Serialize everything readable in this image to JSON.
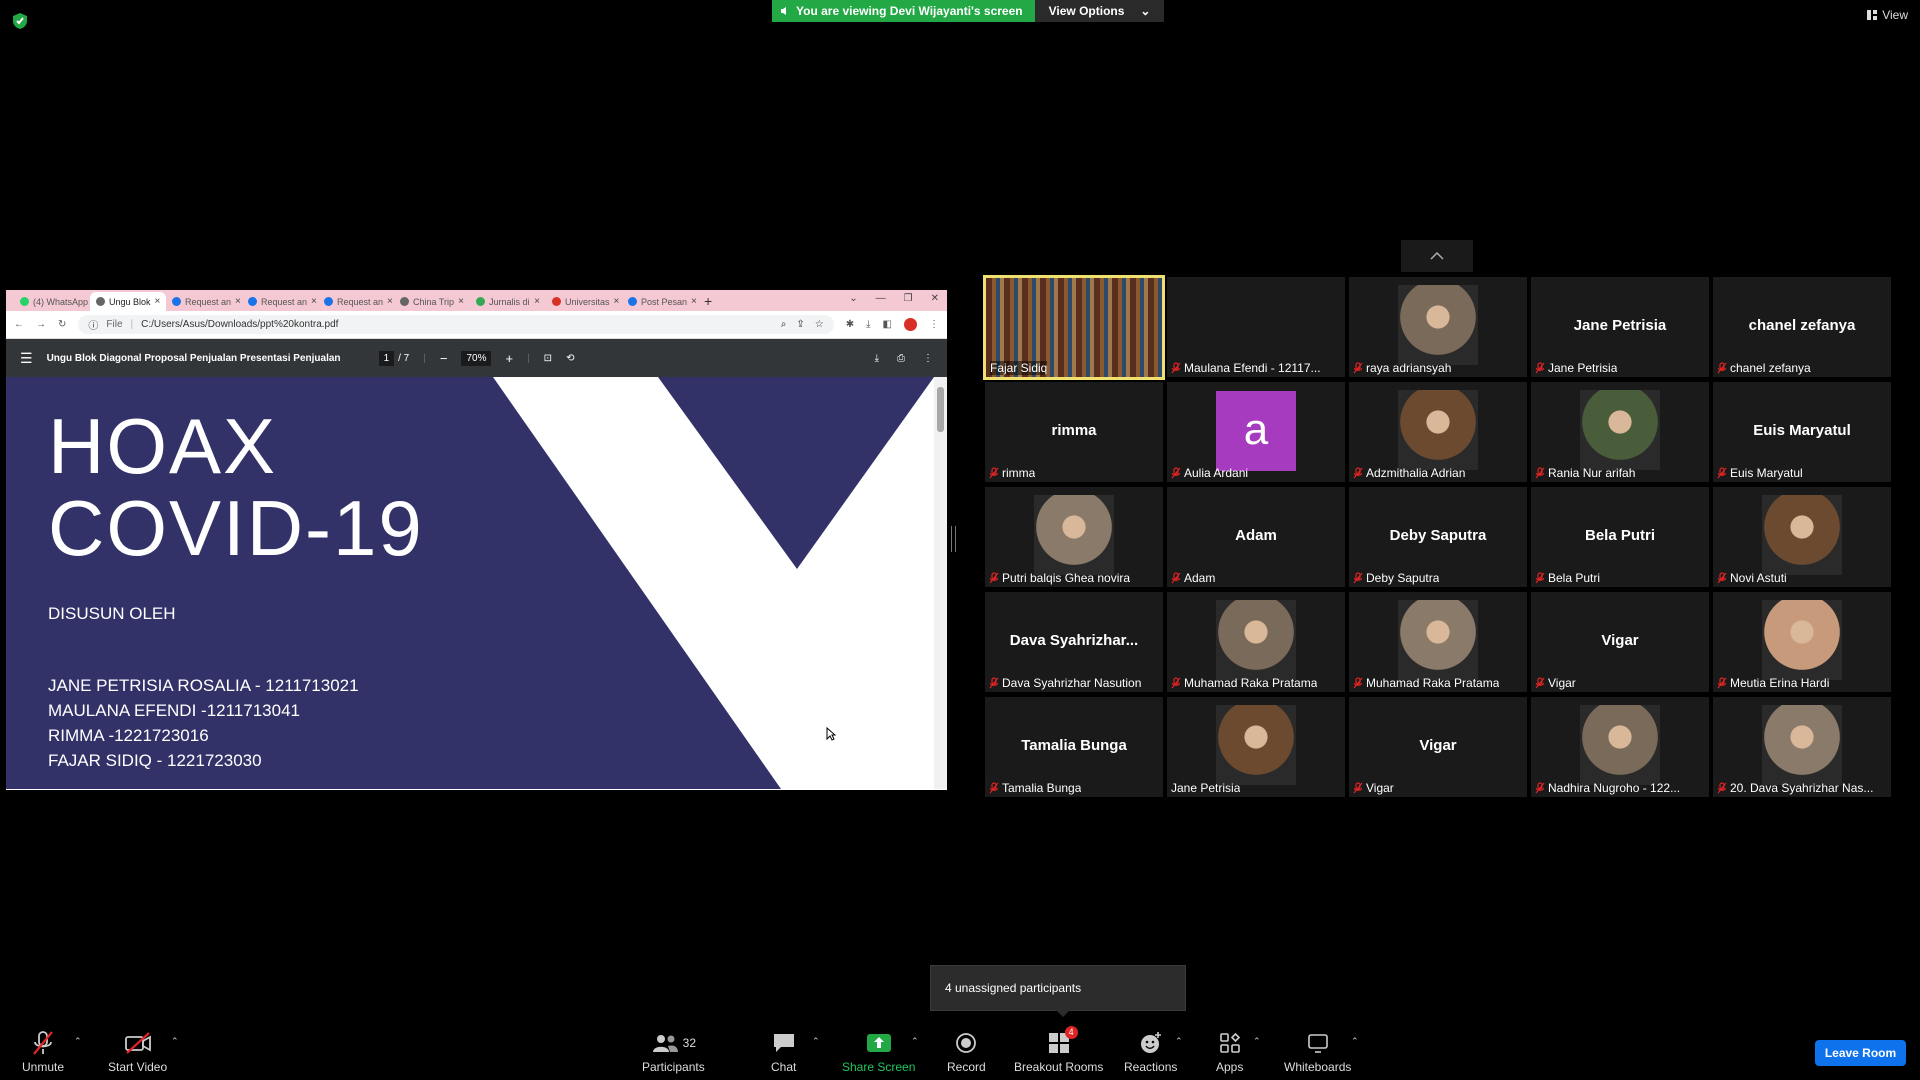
{
  "banner": {
    "viewing_text": "You are viewing Devi Wijayanti's screen",
    "view_options_label": "View Options",
    "view_label": "View"
  },
  "browser": {
    "tabs": [
      {
        "label": "(4) WhatsApp",
        "color": "#25d366"
      },
      {
        "label": "Ungu Blok",
        "color": "#666666"
      },
      {
        "label": "Request an",
        "color": "#1a73e8"
      },
      {
        "label": "Request an",
        "color": "#1a73e8"
      },
      {
        "label": "Request an",
        "color": "#1a73e8"
      },
      {
        "label": "China Trip",
        "color": "#666666"
      },
      {
        "label": "Jurnalis di",
        "color": "#34a853"
      },
      {
        "label": "Universitas",
        "color": "#d93025"
      },
      {
        "label": "Post Pesan",
        "color": "#1a73e8"
      }
    ],
    "address_prefix": "File",
    "address": "C:/Users/Asus/Downloads/ppt%20kontra.pdf"
  },
  "pdf": {
    "title": "Ungu Blok Diagonal Proposal Penjualan Presentasi Penjualan",
    "page_current": "1",
    "page_total": "/ 7",
    "zoom": "70%",
    "slide_title": "HOAX\nCOVID-19",
    "slide_by": "DISUSUN OLEH",
    "slide_names": [
      "JANE PETRISIA ROSALIA - 1211713021",
      "MAULANA EFENDI -1211713041",
      "RIMMA -1221723016",
      "FAJAR SIDIQ - 1221723030"
    ]
  },
  "participants": [
    {
      "name": "Fajar Sidiq",
      "kind": "photo",
      "speaking": true,
      "muted": false
    },
    {
      "name": "Maulana Efendi - 12117...",
      "kind": "blank",
      "muted": true
    },
    {
      "name": "raya adriansyah",
      "kind": "photo",
      "muted": true
    },
    {
      "name": "Jane Petrisia",
      "big": "Jane Petrisia",
      "kind": "text",
      "muted": true
    },
    {
      "name": "chanel zefanya",
      "big": "chanel zefanya",
      "kind": "text",
      "muted": true
    },
    {
      "name": "rimma",
      "big": "rimma",
      "kind": "text",
      "muted": true
    },
    {
      "name": "Aulia Ardani",
      "letter": "a",
      "kind": "letter",
      "muted": true
    },
    {
      "name": "Adzmithalia Adrian",
      "kind": "photo",
      "muted": true
    },
    {
      "name": "Rania Nur arifah",
      "kind": "photo",
      "muted": true
    },
    {
      "name": "Euis Maryatul",
      "big": "Euis Maryatul",
      "kind": "text",
      "muted": true
    },
    {
      "name": "Putri balqis Ghea novira",
      "kind": "photo",
      "muted": true
    },
    {
      "name": "Adam",
      "big": "Adam",
      "kind": "text",
      "muted": true
    },
    {
      "name": "Deby Saputra",
      "big": "Deby Saputra",
      "kind": "text",
      "muted": true
    },
    {
      "name": "Bela Putri",
      "big": "Bela Putri",
      "kind": "text",
      "muted": true
    },
    {
      "name": "Novi Astuti",
      "kind": "photo",
      "muted": true
    },
    {
      "name": "Dava Syahrizhar Nasution",
      "big": "Dava  Syahrizhar...",
      "kind": "text",
      "muted": true
    },
    {
      "name": "Muhamad Raka Pratama",
      "kind": "photo",
      "muted": true
    },
    {
      "name": "Muhamad Raka Pratama",
      "kind": "photo",
      "muted": true
    },
    {
      "name": "Vigar",
      "big": "Vigar",
      "kind": "text",
      "muted": true
    },
    {
      "name": "Meutia Erina Hardi",
      "kind": "photo",
      "muted": true
    },
    {
      "name": "Tamalia Bunga",
      "big": "Tamalia Bunga",
      "kind": "text",
      "muted": true
    },
    {
      "name": "Jane Petrisia",
      "kind": "photo",
      "muted": false
    },
    {
      "name": "Vigar",
      "big": "Vigar",
      "kind": "text",
      "muted": true
    },
    {
      "name": "Nadhira Nugroho - 122...",
      "kind": "photo",
      "muted": true
    },
    {
      "name": "20. Dava Syahrizhar Nas...",
      "kind": "photo",
      "muted": true
    }
  ],
  "breakout_tooltip": "4 unassigned participants",
  "toolbar": {
    "unmute": "Unmute",
    "start_video": "Start Video",
    "participants": "Participants",
    "participants_count": "32",
    "chat": "Chat",
    "share_screen": "Share Screen",
    "record": "Record",
    "breakout_rooms": "Breakout Rooms",
    "breakout_badge": "4",
    "reactions": "Reactions",
    "apps": "Apps",
    "whiteboards": "Whiteboards",
    "leave_room": "Leave Room"
  },
  "colors": {
    "share_green": "#23a846",
    "leave_blue": "#0e72ed",
    "mute_red": "#e02424",
    "slide_purple": "#323269",
    "speaking_yellow": "#f0e070"
  }
}
